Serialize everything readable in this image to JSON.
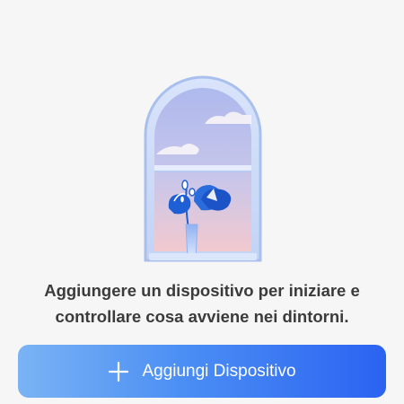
{
  "empty_state": {
    "illustration": "window-with-plant-illustration",
    "message_line1": "Aggiungere un dispositivo per iniziare e",
    "message_line2": "controllare cosa avviene nei dintorni."
  },
  "actions": {
    "add_device_icon": "plus-icon",
    "add_device_label": "Aggiungi Dispositivo"
  },
  "colors": {
    "background": "#f6f6f6",
    "message_text": "#3b3b3b",
    "button_gradient_start": "#7ab3f5",
    "button_gradient_end": "#2b63f1",
    "button_text": "#ffffff"
  }
}
